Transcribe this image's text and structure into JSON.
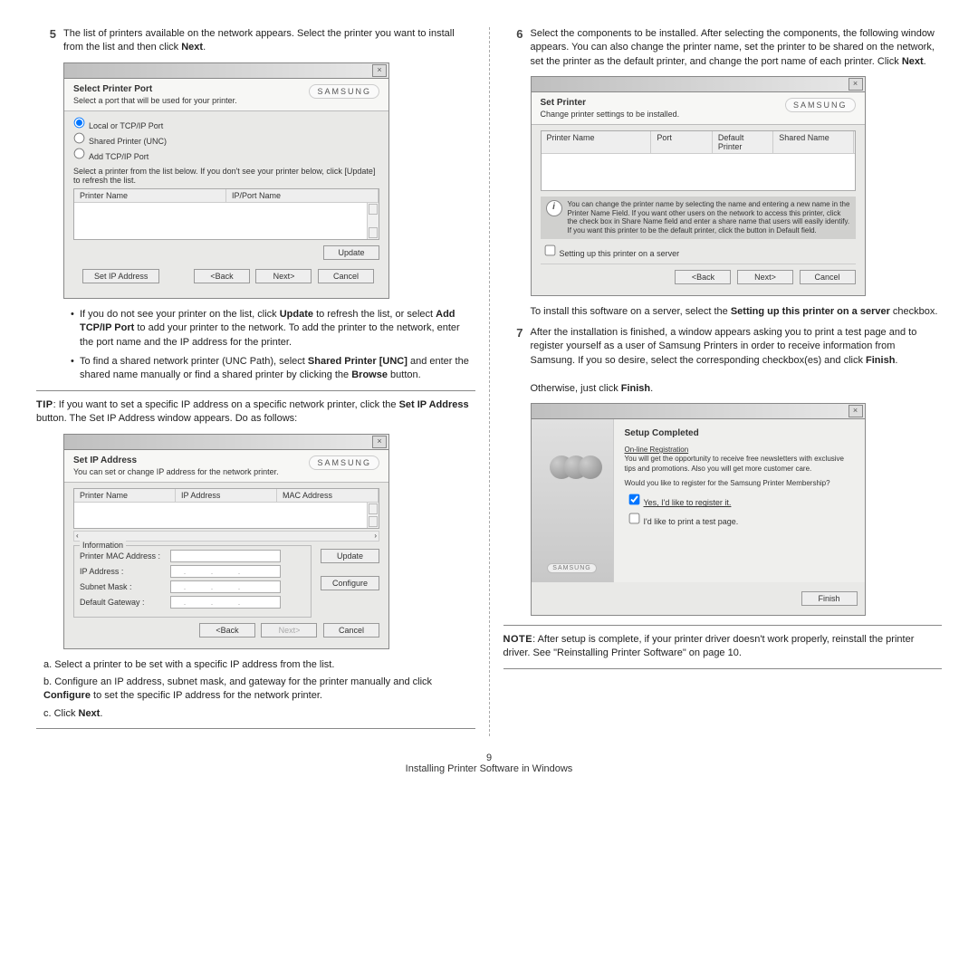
{
  "page_number": "9",
  "footer": "Installing Printer Software in Windows",
  "brand": "SAMSUNG",
  "left": {
    "step5_num": "5",
    "step5_text": "The list of printers available on the network appears. Select the printer you want to install from the list and then click ",
    "step5_bold": "Next",
    "dlg1": {
      "title": "Select Printer Port",
      "sub": "Select a port that will be used for your printer.",
      "r1": "Local or TCP/IP Port",
      "r2": "Shared Printer (UNC)",
      "r3": "Add TCP/IP Port",
      "instr": "Select a printer from the list below. If you don't see your printer below, click [Update] to refresh the list.",
      "col1": "Printer Name",
      "col2": "IP/Port Name",
      "btn_update": "Update",
      "btn_setip": "Set IP Address",
      "btn_back": "<Back",
      "btn_next": "Next>",
      "btn_cancel": "Cancel"
    },
    "bullet1a": "If you do not see your printer on the list, click ",
    "bullet1b": "Update",
    "bullet1c": " to refresh the list, or select ",
    "bullet1d": "Add TCP/IP Port",
    "bullet1e": " to add your printer to the network. To add the printer to the network, enter the port name and the IP address for the printer.",
    "bullet2a": "To find a shared network printer (UNC Path), select ",
    "bullet2b": "Shared Printer [UNC]",
    "bullet2c": " and enter the shared name manually or find a shared printer by clicking the ",
    "bullet2d": "Browse",
    "bullet2e": " button.",
    "tip_label": "TIP",
    "tip_a": ": If you want to set a specific IP address on a specific network printer, click the ",
    "tip_b": "Set IP Address",
    "tip_c": " button. The Set IP Address window appears. Do as follows:",
    "dlg2": {
      "title": "Set IP Address",
      "sub": "You can set or change IP address for the network printer.",
      "col1": "Printer Name",
      "col2": "IP Address",
      "col3": "MAC Address",
      "legend": "Information",
      "l1": "Printer MAC Address :",
      "l2": "IP Address :",
      "l3": "Subnet Mask :",
      "l4": "Default Gateway :",
      "btn_update": "Update",
      "btn_configure": "Configure",
      "btn_back": "<Back",
      "btn_next": "Next>",
      "btn_cancel": "Cancel"
    },
    "la": "a. Select a printer to be set with a specific IP address from the list.",
    "lb_a": "b. Configure an IP address, subnet mask, and gateway for the printer manually and click ",
    "lb_b": "Configure",
    "lb_c": " to set the specific IP address for the network printer.",
    "lc_a": "c. Click ",
    "lc_b": "Next"
  },
  "right": {
    "step6_num": "6",
    "step6_text": "Select the components to be installed. After selecting the components, the following window appears. You can also change the printer name, set the printer to be shared on the network, set the printer as the default printer, and change the port name of each printer. Click ",
    "step6_bold": "Next",
    "dlg3": {
      "title": "Set Printer",
      "sub": "Change printer settings to be installed.",
      "c1": "Printer Name",
      "c2": "Port",
      "c3": "Default Printer",
      "c4": "Shared Name",
      "info": "You can change the printer name by selecting the name and entering a new name in the Printer Name Field. If you want other users on the network to access this printer, click the check box in Share Name field and enter a share name that users will easily identify. If you want this printer to be the default printer, click the button in Default field.",
      "check": "Setting up this printer on a server",
      "btn_back": "<Back",
      "btn_next": "Next>",
      "btn_cancel": "Cancel"
    },
    "server_a": "To install this software on a server, select the ",
    "server_b": "Setting up this printer on a server",
    "server_c": " checkbox.",
    "step7_num": "7",
    "step7_a": "After the installation is finished, a window appears asking you to print a test page and to register yourself as a user of Samsung Printers in order to receive information from Samsung. If you so desire, select the corresponding checkbox(es) and click ",
    "step7_b": "Finish",
    "step7_c": "Otherwise, just click ",
    "step7_d": "Finish",
    "dlg4": {
      "title": "Setup Completed",
      "reg_title": "On-line Registration",
      "reg_text": "You will get the opportunity to receive free newsletters with exclusive tips and promotions. Also you will get more customer care.",
      "question": "Would you like to register for the Samsung Printer Membership?",
      "c1": "Yes, I'd like to register it.",
      "c2": "I'd like to print a test page.",
      "btn_finish": "Finish"
    },
    "note_label": "NOTE",
    "note_text": ": After setup is complete, if your printer driver doesn't work properly, reinstall the printer driver. See \"Reinstalling Printer Software\" on page 10."
  }
}
